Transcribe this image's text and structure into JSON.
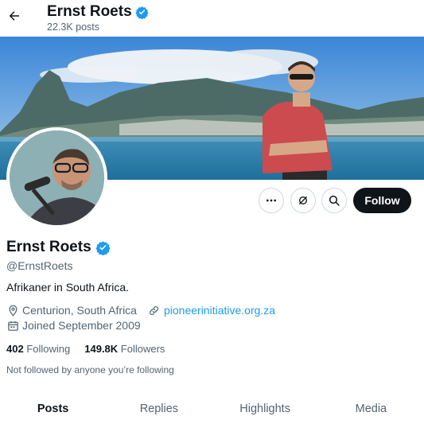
{
  "header": {
    "name": "Ernst Roets",
    "posts_count": "22.3K posts"
  },
  "profile": {
    "name": "Ernst Roets",
    "handle": "@ErnstRoets",
    "bio": "Afrikaner in South Africa.",
    "location": "Centurion, South Africa",
    "website": "pioneerinitiative.org.za",
    "joined": "Joined September 2009",
    "following_count": "402",
    "following_label": "Following",
    "followers_count": "149.8K",
    "followers_label": "Followers",
    "followed_by": "Not followed by anyone you’re following"
  },
  "actions": {
    "follow_label": "Follow"
  },
  "tabs": [
    {
      "label": "Posts"
    },
    {
      "label": "Replies"
    },
    {
      "label": "Highlights"
    },
    {
      "label": "Media"
    }
  ],
  "colors": {
    "accent": "#1d9bf0",
    "verified": "#1d9bf0",
    "text_primary": "#0f1419",
    "text_secondary": "#536471",
    "follow_button": "#0f1419"
  },
  "icons": {
    "back": "arrow-left-icon",
    "verified": "verified-badge-icon",
    "more": "more-horizontal-icon",
    "subscribe": "grok-icon",
    "search": "search-icon",
    "location": "location-pin-icon",
    "link": "link-icon",
    "calendar": "calendar-icon"
  }
}
